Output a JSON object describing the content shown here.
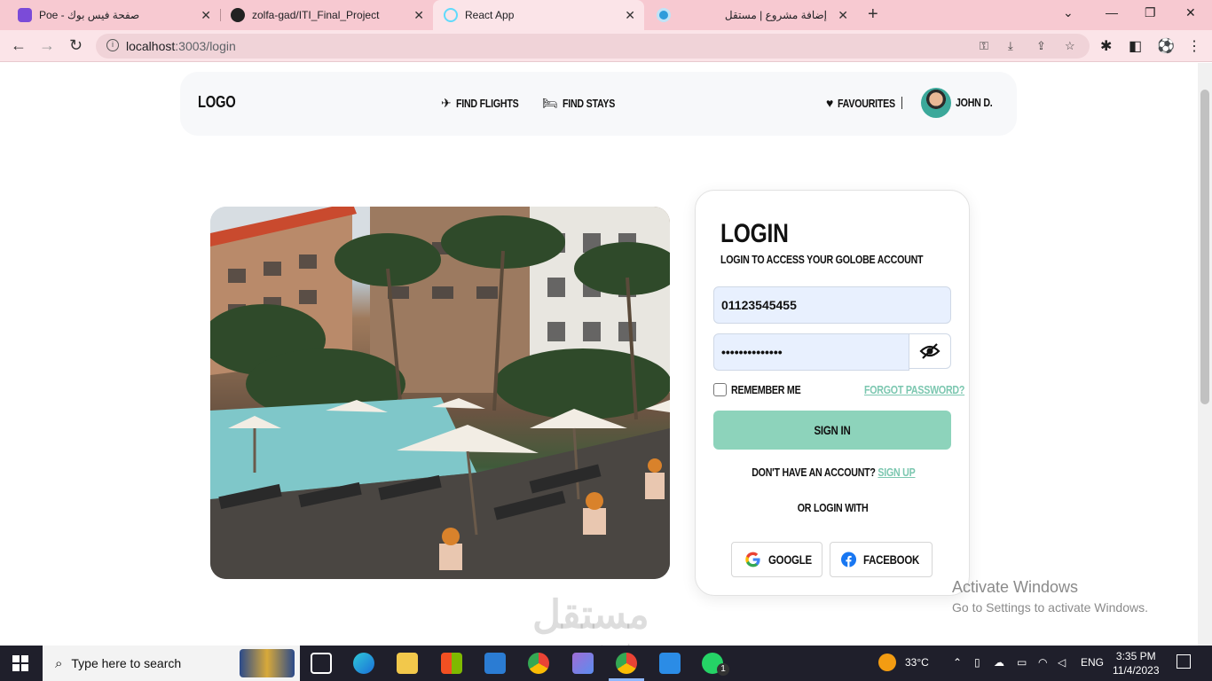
{
  "browser": {
    "tabs": [
      {
        "title": "Poe - صفحة فيس بوك",
        "favicon_color": "#7b4bd8"
      },
      {
        "title": "zolfa-gad/ITI_Final_Project",
        "favicon_color": "#222222"
      },
      {
        "title": "React App",
        "favicon_color": "#61dafb"
      },
      {
        "title": "إضافة مشروع | مستقل",
        "favicon_color": "#2d9cdb"
      }
    ],
    "url_host": "localhost",
    "url_rest": ":3003/login"
  },
  "nav": {
    "logo": "LOGO",
    "find_flights": "FIND FLIGHTS",
    "find_stays": "FIND STAYS",
    "favourites": "FAVOURITES",
    "user_name": "JOHN D."
  },
  "login": {
    "title": "LOGIN",
    "subtitle": "LOGIN TO ACCESS YOUR GOLOBE ACCOUNT",
    "phone_value": "01123545455",
    "password_value": "••••••••••••••",
    "remember_me": "REMEMBER ME",
    "forgot_password": "FORGOT PASSWORD?",
    "sign_in": "SIGN IN",
    "no_account": "DON'T HAVE AN ACCOUNT?",
    "sign_up": "SIGN UP",
    "or_login_with": "OR LOGIN WITH",
    "google": "GOOGLE",
    "facebook": "FACEBOOK"
  },
  "system": {
    "activate_title": "Activate Windows",
    "activate_sub": "Go to Settings to activate Windows.",
    "watermark": "مستقل",
    "watermark_sub": "mostaql.com",
    "search_placeholder": "Type here to search",
    "temperature": "33°C",
    "language": "ENG",
    "time": "3:35 PM",
    "date": "11/4/2023",
    "whatsapp_badge": "1"
  },
  "colors": {
    "accent": "#8dd3bb",
    "tabbar": "#f7c9d1"
  }
}
